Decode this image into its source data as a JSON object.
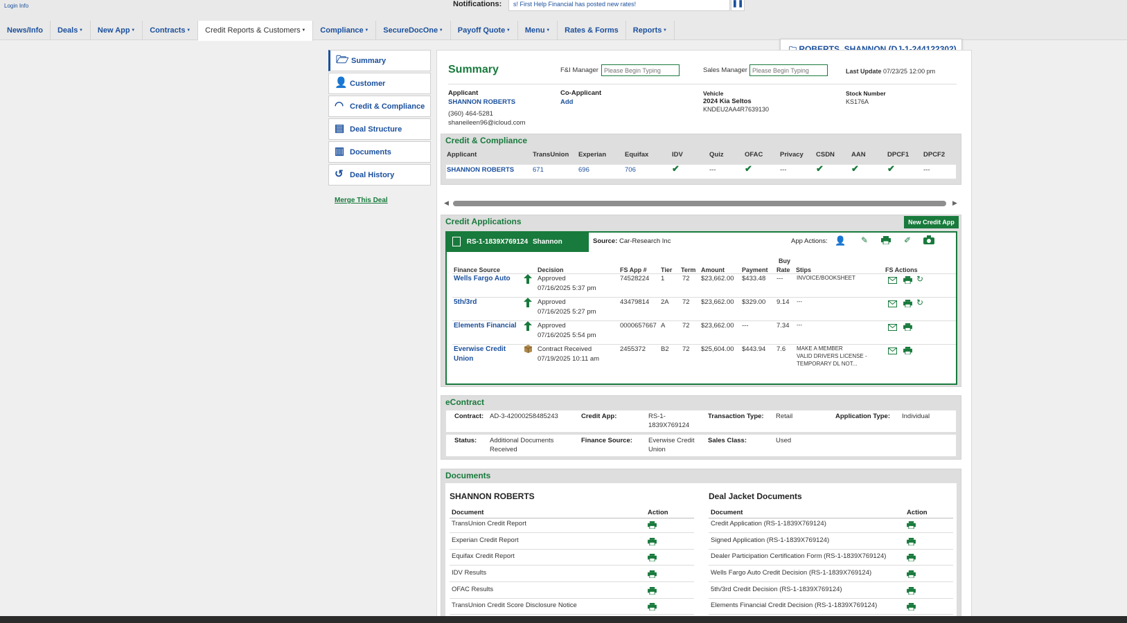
{
  "header": {
    "login": "Login",
    "info": "Info",
    "notifications_label": "Notifications:",
    "notification_text": "s!     First Help Financial has posted new rates!",
    "pause_icon": "pause-icon"
  },
  "nav": [
    {
      "label": "News/Info",
      "caret": false
    },
    {
      "label": "Deals",
      "caret": true
    },
    {
      "label": "New App",
      "caret": true
    },
    {
      "label": "Contracts",
      "caret": true
    },
    {
      "label": "Credit Reports & Customers",
      "caret": true,
      "active": true
    },
    {
      "label": "Compliance",
      "caret": true
    },
    {
      "label": "SecureDocOne",
      "caret": true
    },
    {
      "label": "Payoff Quote",
      "caret": true
    },
    {
      "label": "Menu",
      "caret": true
    },
    {
      "label": "Rates & Forms",
      "caret": false
    },
    {
      "label": "Reports",
      "caret": true
    }
  ],
  "deal_tag": "ROBERTS, SHANNON (DJ-1-244122302)",
  "sidebar": {
    "items": [
      {
        "label": "Summary",
        "icon": "folder-icon"
      },
      {
        "label": "Customer",
        "icon": "person-icon"
      },
      {
        "label": "Credit & Compliance",
        "icon": "gauge-icon"
      },
      {
        "label": "Deal Structure",
        "icon": "calculator-icon"
      },
      {
        "label": "Documents",
        "icon": "document-icon"
      },
      {
        "label": "Deal History",
        "icon": "history-icon"
      }
    ],
    "merge": "Merge This Deal"
  },
  "summary": {
    "title": "Summary",
    "fi_manager_label": "F&I Manager",
    "fi_manager_placeholder": "Please Begin Typing",
    "sales_manager_label": "Sales Manager",
    "sales_manager_placeholder": "Please Begin Typing",
    "last_update_label": "Last Update",
    "last_update_value": "07/23/25 12:00 pm",
    "applicant_label": "Applicant",
    "applicant_name": "SHANNON ROBERTS",
    "applicant_phone": "(360) 464-5281",
    "applicant_email": "shaneileen96@icloud.com",
    "coapplicant_label": "Co-Applicant",
    "coapplicant_add": "Add",
    "vehicle_label": "Vehicle",
    "vehicle_name": "2024 Kia Seltos",
    "vehicle_vin": "KNDEU2AA4R7639130",
    "stock_label": "Stock Number",
    "stock_value": "KS176A"
  },
  "credit_compliance": {
    "title": "Credit & Compliance",
    "headers": [
      "Applicant",
      "TransUnion",
      "Experian",
      "Equifax",
      "IDV",
      "Quiz",
      "OFAC",
      "Privacy",
      "CSDN",
      "AAN",
      "DPCF1",
      "DPCF2"
    ],
    "row": {
      "applicant": "SHANNON ROBERTS",
      "transunion": "671",
      "experian": "696",
      "equifax": "706",
      "idv": "✔",
      "quiz": "---",
      "ofac": "✔",
      "privacy": "---",
      "csdn": "✔",
      "aan": "✔",
      "dpcf1": "✔",
      "dpcf2": "---"
    }
  },
  "credit_apps": {
    "title": "Credit Applications",
    "new_button": "New Credit App",
    "app_id": "RS-1-1839X769124",
    "app_name": "Shannon Roberts",
    "source_label": "Source:",
    "source_value": "Car-Research Inc",
    "app_actions_label": "App Actions:",
    "headers": {
      "finance_source": "Finance Source",
      "decision": "Decision",
      "fs_app": "FS App #",
      "tier": "Tier",
      "term": "Term",
      "amount": "Amount",
      "payment": "Payment",
      "buy_rate_1": "Buy",
      "buy_rate_2": "Rate",
      "stips": "Stips",
      "fs_actions": "FS Actions"
    },
    "rows": [
      {
        "source": "Wells Fargo Auto",
        "source2": "",
        "status_icon": "arrow-up-icon",
        "decision": "Approved",
        "date": "07/16/2025 5:37 pm",
        "fs_app": "74528224",
        "tier": "1",
        "term": "72",
        "amount": "$23,662.00",
        "payment": "$433.48",
        "buy_rate": "---",
        "stips1": "INVOICE/BOOKSHEET",
        "stips2": "",
        "stips3": "",
        "refresh": true
      },
      {
        "source": "5th/3rd",
        "source2": "",
        "status_icon": "arrow-up-icon",
        "decision": "Approved",
        "date": "07/16/2025 5:27 pm",
        "fs_app": "43479814",
        "tier": "2A",
        "term": "72",
        "amount": "$23,662.00",
        "payment": "$329.00",
        "buy_rate": "9.14",
        "stips1": "---",
        "stips2": "",
        "stips3": "",
        "refresh": true
      },
      {
        "source": "Elements Financial",
        "source2": "",
        "status_icon": "arrow-up-icon",
        "decision": "Approved",
        "date": "07/16/2025 5:54 pm",
        "fs_app": "0000657667",
        "tier": "A",
        "term": "72",
        "amount": "$23,662.00",
        "payment": "---",
        "buy_rate": "7.34",
        "stips1": "---",
        "stips2": "",
        "stips3": "",
        "refresh": false
      },
      {
        "source": "Everwise Credit",
        "source2": "Union",
        "status_icon": "box-icon",
        "decision": "Contract Received",
        "date": "07/19/2025 10:11 am",
        "fs_app": "2455372",
        "tier": "B2",
        "term": "72",
        "amount": "$25,604.00",
        "payment": "$443.94",
        "buy_rate": "7.6",
        "stips1": "MAKE A MEMBER",
        "stips2": "VALID DRIVERS LICENSE -",
        "stips3": "TEMPORARY DL NOT...",
        "refresh": false
      }
    ]
  },
  "econtract": {
    "title": "eContract",
    "contract_label": "Contract:",
    "contract_value": "AD-3-42000258485243",
    "credit_app_label": "Credit App:",
    "credit_app_value1": "RS-1-",
    "credit_app_value2": "1839X769124",
    "transaction_label": "Transaction Type:",
    "transaction_value": "Retail",
    "application_label": "Application Type:",
    "application_value": "Individual",
    "status_label": "Status:",
    "status_value1": "Additional Documents",
    "status_value2": "Received",
    "finance_label": "Finance Source:",
    "finance_value1": "Everwise Credit",
    "finance_value2": "Union",
    "sales_class_label": "Sales Class:",
    "sales_class_value": "Used"
  },
  "documents": {
    "title": "Documents",
    "left_title": "SHANNON ROBERTS",
    "right_title": "Deal Jacket Documents",
    "doc_header": "Document",
    "action_header": "Action",
    "left": [
      "TransUnion Credit Report",
      "Experian Credit Report",
      "Equifax Credit Report",
      "IDV Results",
      "OFAC Results",
      "TransUnion Credit Score Disclosure Notice"
    ],
    "right": [
      "Credit Application (RS-1-1839X769124)",
      "Signed Application (RS-1-1839X769124)",
      "Dealer Participation Certification Form (RS-1-1839X769124)",
      "Wells Fargo Auto Credit Decision (RS-1-1839X769124)",
      "5th/3rd Credit Decision (RS-1-1839X769124)",
      "Elements Financial Credit Decision (RS-1-1839X769124)"
    ]
  }
}
